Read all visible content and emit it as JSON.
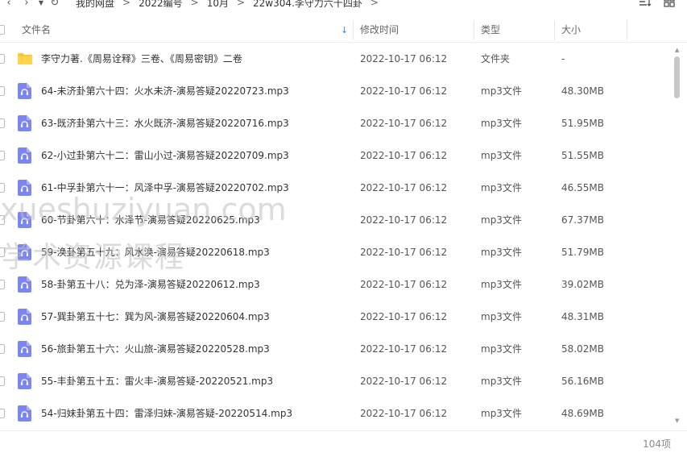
{
  "breadcrumb": {
    "items": [
      "我的网盘",
      "2022编号",
      "10月",
      "22w304.李守力六十四卦"
    ],
    "separator": ">",
    "trailing_separator": ">"
  },
  "header": {
    "name": "文件名",
    "mtime": "修改时间",
    "type": "类型",
    "size": "大小",
    "sort_indicator": "↓"
  },
  "rows": [
    {
      "icon": "folder-icon",
      "name": "李守力著.《周易诠释》三卷、《周易密钥》二卷",
      "mtime": "2022-10-17 06:12",
      "type": "文件夹",
      "size": "-"
    },
    {
      "icon": "audio-file-icon",
      "name": "64-未济卦第六十四：火水未济-演易答疑20220723.mp3",
      "mtime": "2022-10-17 06:12",
      "type": "mp3文件",
      "size": "48.30MB"
    },
    {
      "icon": "audio-file-icon",
      "name": "63-既济卦第六十三：水火既济-演易答疑20220716.mp3",
      "mtime": "2022-10-17 06:12",
      "type": "mp3文件",
      "size": "51.95MB"
    },
    {
      "icon": "audio-file-icon",
      "name": "62-小过卦第六十二：雷山小过-演易答疑20220709.mp3",
      "mtime": "2022-10-17 06:12",
      "type": "mp3文件",
      "size": "51.55MB"
    },
    {
      "icon": "audio-file-icon",
      "name": "61-中孚卦第六十一：风泽中孚-演易答疑20220702.mp3",
      "mtime": "2022-10-17 06:12",
      "type": "mp3文件",
      "size": "46.55MB"
    },
    {
      "icon": "audio-file-icon",
      "name": "60-节卦第六十：水泽节-演易答疑20220625.mp3",
      "mtime": "2022-10-17 06:12",
      "type": "mp3文件",
      "size": "67.37MB"
    },
    {
      "icon": "audio-file-icon",
      "name": "59-涣卦第五十九：风水涣-演易答疑20220618.mp3",
      "mtime": "2022-10-17 06:12",
      "type": "mp3文件",
      "size": "51.79MB"
    },
    {
      "icon": "audio-file-icon",
      "name": "58-卦第五十八：兑为泽-演易答疑20220612.mp3",
      "mtime": "2022-10-17 06:12",
      "type": "mp3文件",
      "size": "39.02MB"
    },
    {
      "icon": "audio-file-icon",
      "name": "57-巽卦第五十七：巽为风-演易答疑20220604.mp3",
      "mtime": "2022-10-17 06:12",
      "type": "mp3文件",
      "size": "48.31MB"
    },
    {
      "icon": "audio-file-icon",
      "name": "56-旅卦第五十六：火山旅-演易答疑20220528.mp3",
      "mtime": "2022-10-17 06:12",
      "type": "mp3文件",
      "size": "58.02MB"
    },
    {
      "icon": "audio-file-icon",
      "name": "55-丰卦第五十五：雷火丰-演易答疑-20220521.mp3",
      "mtime": "2022-10-17 06:12",
      "type": "mp3文件",
      "size": "56.16MB"
    },
    {
      "icon": "audio-file-icon",
      "name": "54-归妹卦第五十四：雷泽归妹-演易答疑-20220514.mp3",
      "mtime": "2022-10-17 06:12",
      "type": "mp3文件",
      "size": "48.69MB"
    }
  ],
  "footer": {
    "count": "104项"
  },
  "watermark": {
    "line1": "xueshuziyuan.com",
    "line2": "学术资源课程"
  },
  "colors": {
    "accent": "#3b83f7",
    "folder": "#ffc532",
    "audio_icon": "#7b86f0"
  }
}
